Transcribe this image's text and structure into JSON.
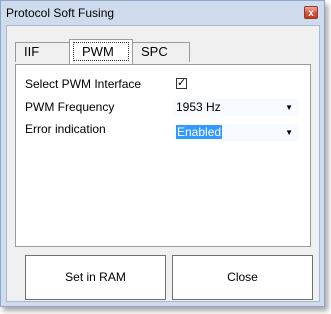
{
  "window": {
    "title": "Protocol Soft Fusing",
    "close_glyph": "x"
  },
  "tabs": [
    {
      "label": "IIF",
      "active": false
    },
    {
      "label": "PWM",
      "active": true
    },
    {
      "label": "SPC",
      "active": false
    }
  ],
  "form": {
    "select_pwm_label": "Select PWM Interface",
    "select_pwm_checked": true,
    "pwm_frequency_label": "PWM Frequency",
    "pwm_frequency_value": "1953 Hz",
    "error_indication_label": "Error indication",
    "error_indication_value": "Enabled"
  },
  "buttons": {
    "set_in_ram": "Set in RAM",
    "close": "Close"
  },
  "colors": {
    "selection": "#3399ff",
    "frame": "#cfdcee"
  }
}
